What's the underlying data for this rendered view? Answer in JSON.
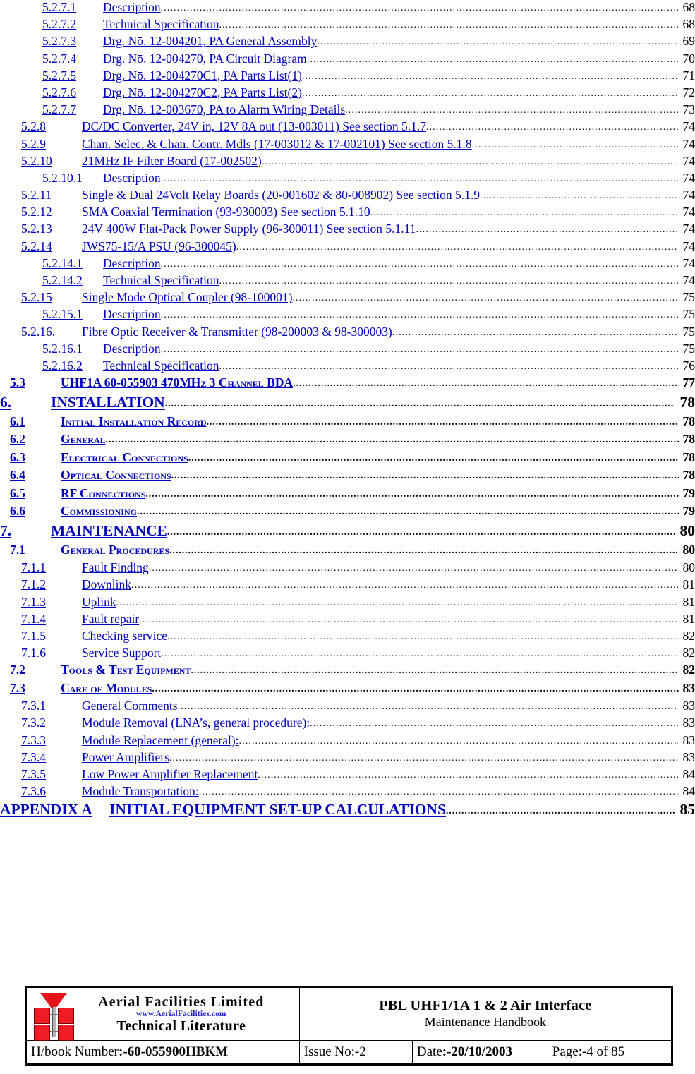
{
  "document": {
    "type": "table-of-contents"
  },
  "toc": {
    "entries": [
      {
        "level": 4,
        "num": "5.2.7.1",
        "title": "Description",
        "page": "68"
      },
      {
        "level": 4,
        "num": "5.2.7.2",
        "title": "Technical Specification",
        "page": "68"
      },
      {
        "level": 4,
        "num": "5.2.7.3",
        "title": "Drg. Nō. 12-004201, PA General Assembly",
        "page": "69"
      },
      {
        "level": 4,
        "num": "5.2.7.4",
        "title": "Drg. Nō. 12-004270, PA Circuit Diagram",
        "page": "70"
      },
      {
        "level": 4,
        "num": "5.2.7.5",
        "title": "Drg. Nō. 12-004270C1, PA Parts List(1)",
        "page": "71"
      },
      {
        "level": 4,
        "num": "5.2.7.6",
        "title": "Drg. Nō. 12-004270C2, PA Parts List(2)",
        "page": "72"
      },
      {
        "level": 4,
        "num": "5.2.7.7",
        "title": "Drg. Nō. 12-003670, PA to Alarm Wiring Details",
        "page": "73"
      },
      {
        "level": 3,
        "num": "5.2.8",
        "title": "DC/DC Converter, 24V in, 12V 8A out (13-003011) See section 5.1.7",
        "page": "74"
      },
      {
        "level": 3,
        "num": "5.2.9",
        "title": "Chan. Selec. & Chan. Contr. Mdls (17-003012 & 17-002101) See section 5.1.8",
        "page": "74"
      },
      {
        "level": 3,
        "num": "5.2.10",
        "title": "21MHz IF Filter Board (17-002502)",
        "page": "74"
      },
      {
        "level": 4,
        "num": "5.2.10.1",
        "title": "Description",
        "page": "74"
      },
      {
        "level": 3,
        "num": "5.2.11",
        "title": "Single & Dual 24Volt Relay Boards (20-001602 & 80-008902) See section 5.1.9",
        "page": "74"
      },
      {
        "level": 3,
        "num": "5.2.12",
        "title": "SMA Coaxial Termination (93-930003) See section 5.1.10",
        "page": "74"
      },
      {
        "level": 3,
        "num": "5.2.13",
        "title": "24V 400W Flat-Pack Power Supply (96-300011) See section 5.1.11",
        "page": "74"
      },
      {
        "level": 3,
        "num": "5.2.14",
        "title": "JWS75-15/A PSU (96-300045)",
        "page": "74"
      },
      {
        "level": 4,
        "num": "5.2.14.1",
        "title": "Description",
        "page": "74"
      },
      {
        "level": 4,
        "num": "5.2.14.2",
        "title": "Technical Specification",
        "page": "74"
      },
      {
        "level": 3,
        "num": "5.2.15",
        "title": "Single Mode Optical Coupler (98-100001)",
        "page": "75"
      },
      {
        "level": 4,
        "num": "5.2.15.1",
        "title": "Description",
        "page": "75"
      },
      {
        "level": 3,
        "num": "5.2.16.",
        "title": "Fibre Optic Receiver & Transmitter (98-200003 & 98-300003)",
        "page": "75"
      },
      {
        "level": 4,
        "num": "5.2.16.1",
        "title": "Description",
        "page": "75"
      },
      {
        "level": 4,
        "num": "5.2.16.2",
        "title": "Technical Specification",
        "page": "76"
      },
      {
        "level": 2,
        "num": "5.3",
        "title": "UHF1A 60-055903 470MHz 3 Channel BDA",
        "page": "77"
      },
      {
        "level": 1,
        "num": "6.",
        "title": "INSTALLATION",
        "page": "78"
      },
      {
        "level": 2,
        "num": "6.1",
        "title": "Initial Installation Record",
        "page": "78"
      },
      {
        "level": 2,
        "num": "6.2",
        "title": "General",
        "page": "78"
      },
      {
        "level": 2,
        "num": "6.3",
        "title": "Electrical Connections",
        "page": "78"
      },
      {
        "level": 2,
        "num": "6.4",
        "title": "Optical Connections",
        "page": "78"
      },
      {
        "level": 2,
        "num": "6.5",
        "title": "RF Connections",
        "page": "79"
      },
      {
        "level": 2,
        "num": "6.6",
        "title": "Commissioning",
        "page": "79"
      },
      {
        "level": 1,
        "num": "7.",
        "title": "MAINTENANCE",
        "page": "80"
      },
      {
        "level": 2,
        "num": "7.1",
        "title": "General Procedures",
        "page": "80"
      },
      {
        "level": 3,
        "num": "7.1.1",
        "title": "Fault Finding",
        "page": "80"
      },
      {
        "level": 3,
        "num": "7.1.2",
        "title": "Downlink",
        "page": "81"
      },
      {
        "level": 3,
        "num": "7.1.3",
        "title": "Uplink",
        "page": "81"
      },
      {
        "level": 3,
        "num": "7.1.4",
        "title": "Fault repair",
        "page": "81"
      },
      {
        "level": 3,
        "num": "7.1.5",
        "title": "Checking service",
        "page": "82"
      },
      {
        "level": 3,
        "num": "7.1.6",
        "title": "Service Support",
        "page": "82"
      },
      {
        "level": 2,
        "num": "7.2",
        "title": "Tools & Test Equipment",
        "page": "82"
      },
      {
        "level": 2,
        "num": "7.3",
        "title": "Care of Modules",
        "page": "83"
      },
      {
        "level": 3,
        "num": "7.3.1",
        "title": "General Comments",
        "page": "83"
      },
      {
        "level": 3,
        "num": "7.3.2",
        "title": "Module Removal (LNA’s, general procedure):",
        "page": "83"
      },
      {
        "level": 3,
        "num": "7.3.3",
        "title": "Module Replacement (general):",
        "page": "83"
      },
      {
        "level": 3,
        "num": "7.3.4",
        "title": "Power Amplifiers",
        "page": "83"
      },
      {
        "level": 3,
        "num": "7.3.5",
        "title": "Low Power Amplifier Replacement",
        "page": "84"
      },
      {
        "level": 3,
        "num": "7.3.6",
        "title": "Module Transportation:",
        "page": "84"
      },
      {
        "level": 0,
        "num": "APPENDIX A",
        "title": "INITIAL EQUIPMENT SET-UP CALCULATIONS",
        "page": "85"
      }
    ]
  },
  "footer": {
    "logo": {
      "company": "Aerial  Facilities  Limited",
      "website": "www.AerialFacilities.com",
      "tagline": "Technical Literature",
      "mark_color": "#ee1c24",
      "website_color": "#2222cc"
    },
    "title": {
      "main": "PBL UHF1/1A 1 & 2 Air Interface",
      "sub": "Maintenance Handbook"
    },
    "meta": {
      "hbook_label": "H/book Number",
      "hbook_value": ":-60-055900HBKM",
      "issue_label": "Issue No",
      "issue_value": ":-2",
      "date_label": "Date",
      "date_value": ":-20/10/2003",
      "page_label": "Page",
      "page_value": ":-4 of 85"
    }
  }
}
